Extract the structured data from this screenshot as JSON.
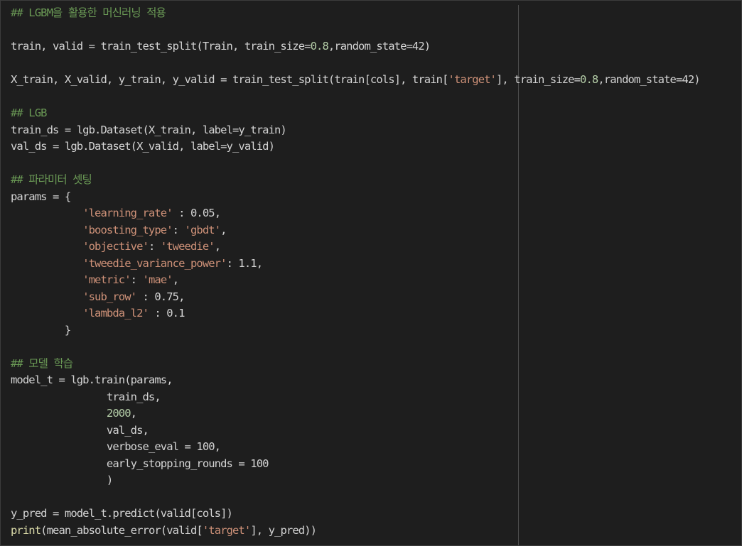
{
  "colors": {
    "background": "#1e1e1e",
    "text": "#d4d4d4",
    "comment": "#6a9955",
    "string": "#ce9178",
    "number": "#b5cea8",
    "builtin": "#dcdcaa",
    "ruler": "#4a4a4a"
  },
  "code_lines": [
    [
      {
        "t": "comment",
        "v": "## LGBM을 활용한 머신러닝 적용"
      }
    ],
    [],
    [
      {
        "t": "plain",
        "v": "train, valid = train_test_split(Train, train_size="
      },
      {
        "t": "number",
        "v": "0.8"
      },
      {
        "t": "plain",
        "v": ",random_state=42)"
      }
    ],
    [],
    [
      {
        "t": "plain",
        "v": "X_train, X_valid, y_train, y_valid = train_test_split(train[cols], train["
      },
      {
        "t": "string",
        "v": "'target'"
      },
      {
        "t": "plain",
        "v": "], train_size="
      },
      {
        "t": "number",
        "v": "0.8"
      },
      {
        "t": "plain",
        "v": ",random_state=42)"
      }
    ],
    [],
    [
      {
        "t": "comment",
        "v": "## LGB"
      }
    ],
    [
      {
        "t": "plain",
        "v": "train_ds = lgb.Dataset(X_train, label=y_train)"
      }
    ],
    [
      {
        "t": "plain",
        "v": "val_ds = lgb.Dataset(X_valid, label=y_valid)"
      }
    ],
    [],
    [
      {
        "t": "comment",
        "v": "## 파라미터 셋팅"
      }
    ],
    [
      {
        "t": "plain",
        "v": "params = {"
      }
    ],
    [
      {
        "t": "plain",
        "v": "            "
      },
      {
        "t": "string",
        "v": "'learning_rate'"
      },
      {
        "t": "plain",
        "v": " : 0.05,"
      }
    ],
    [
      {
        "t": "plain",
        "v": "            "
      },
      {
        "t": "string",
        "v": "'boosting_type'"
      },
      {
        "t": "plain",
        "v": ": "
      },
      {
        "t": "string",
        "v": "'gbdt'"
      },
      {
        "t": "plain",
        "v": ","
      }
    ],
    [
      {
        "t": "plain",
        "v": "            "
      },
      {
        "t": "string",
        "v": "'objective'"
      },
      {
        "t": "plain",
        "v": ": "
      },
      {
        "t": "string",
        "v": "'tweedie'"
      },
      {
        "t": "plain",
        "v": ","
      }
    ],
    [
      {
        "t": "plain",
        "v": "            "
      },
      {
        "t": "string",
        "v": "'tweedie_variance_power'"
      },
      {
        "t": "plain",
        "v": ": 1.1,"
      }
    ],
    [
      {
        "t": "plain",
        "v": "            "
      },
      {
        "t": "string",
        "v": "'metric'"
      },
      {
        "t": "plain",
        "v": ": "
      },
      {
        "t": "string",
        "v": "'mae'"
      },
      {
        "t": "plain",
        "v": ","
      }
    ],
    [
      {
        "t": "plain",
        "v": "            "
      },
      {
        "t": "string",
        "v": "'sub_row'"
      },
      {
        "t": "plain",
        "v": " : 0.75,"
      }
    ],
    [
      {
        "t": "plain",
        "v": "            "
      },
      {
        "t": "string",
        "v": "'lambda_l2'"
      },
      {
        "t": "plain",
        "v": " : 0.1"
      }
    ],
    [
      {
        "t": "plain",
        "v": "         }"
      }
    ],
    [],
    [
      {
        "t": "comment",
        "v": "## 모델 학습"
      }
    ],
    [
      {
        "t": "plain",
        "v": "model_t = lgb.train(params,"
      }
    ],
    [
      {
        "t": "plain",
        "v": "                train_ds,"
      }
    ],
    [
      {
        "t": "plain",
        "v": "                "
      },
      {
        "t": "number",
        "v": "2000"
      },
      {
        "t": "plain",
        "v": ","
      }
    ],
    [
      {
        "t": "plain",
        "v": "                val_ds,"
      }
    ],
    [
      {
        "t": "plain",
        "v": "                verbose_eval = 100,"
      }
    ],
    [
      {
        "t": "plain",
        "v": "                early_stopping_rounds = 100"
      }
    ],
    [
      {
        "t": "plain",
        "v": "                )"
      }
    ],
    [],
    [
      {
        "t": "plain",
        "v": "y_pred = model_t.predict(valid[cols])"
      }
    ],
    [
      {
        "t": "builtin",
        "v": "print"
      },
      {
        "t": "plain",
        "v": "(mean_absolute_error(valid["
      },
      {
        "t": "string",
        "v": "'target'"
      },
      {
        "t": "plain",
        "v": "], y_pred))"
      }
    ]
  ]
}
